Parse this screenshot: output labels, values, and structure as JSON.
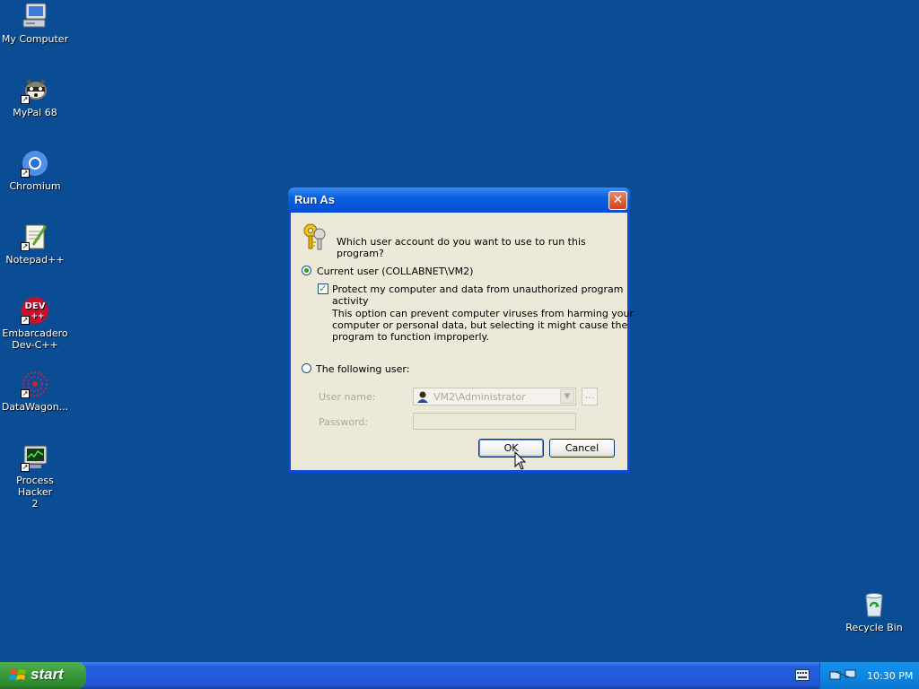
{
  "desktop": {
    "icons": [
      {
        "label": "My Computer",
        "icon": "computer-icon"
      },
      {
        "label": "MyPal 68",
        "icon": "raccoon-icon"
      },
      {
        "label": "Chromium",
        "icon": "chromium-icon"
      },
      {
        "label": "Notepad++",
        "icon": "notepad-plus-plus-icon"
      },
      {
        "label": "Embarcadero\nDev-C++",
        "icon": "dev-cpp-icon"
      },
      {
        "label": "DataWagon...",
        "icon": "datawagon-icon"
      },
      {
        "label": "Process Hacker\n2",
        "icon": "process-hacker-icon"
      },
      {
        "label": "Recycle Bin",
        "icon": "recycle-bin-icon"
      }
    ]
  },
  "dialog": {
    "title": "Run As",
    "question": "Which user account do you want to use to run this program?",
    "current_user_label": "Current user (COLLABNET\\VM2)",
    "current_user_selected": true,
    "protect_label": "Protect my computer and data from unauthorized program activity",
    "protect_checked": true,
    "description": "This option can prevent computer viruses from harming your computer or personal data, but selecting it might cause the program to function improperly.",
    "following_user_label": "The following user:",
    "following_user_selected": false,
    "user_name_label": "User name:",
    "user_name_value": "VM2\\Administrator",
    "browse_label": "...",
    "password_label": "Password:",
    "password_value": "",
    "ok_label": "OK",
    "cancel_label": "Cancel"
  },
  "taskbar": {
    "start_label": "start",
    "clock": "10:30 PM"
  },
  "colors": {
    "desktop": "#0b4d94",
    "title_bar": "#0553d8",
    "dialog_face": "#ece9d8",
    "start_button": "#3c9b3c",
    "tray": "#0f8ae2"
  }
}
